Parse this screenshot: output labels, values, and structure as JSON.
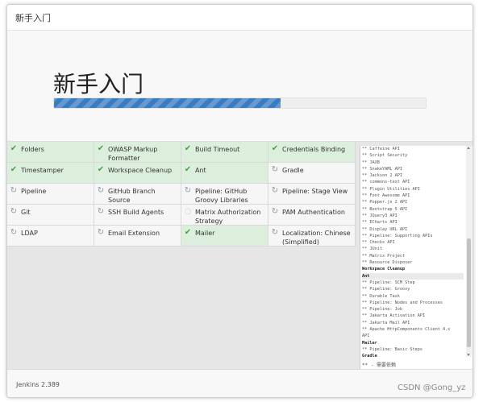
{
  "dialog": {
    "title": "新手入门"
  },
  "hero": {
    "title": "新手入门",
    "progress": 0.61
  },
  "plugins": [
    {
      "name": "Folders",
      "status": "done"
    },
    {
      "name": "OWASP Markup Formatter",
      "status": "done"
    },
    {
      "name": "Build Timeout",
      "status": "done"
    },
    {
      "name": "Credentials Binding",
      "status": "done"
    },
    {
      "name": "Timestamper",
      "status": "done"
    },
    {
      "name": "Workspace Cleanup",
      "status": "done"
    },
    {
      "name": "Ant",
      "status": "done"
    },
    {
      "name": "Gradle",
      "status": "loading"
    },
    {
      "name": "Pipeline",
      "status": "loading"
    },
    {
      "name": "GitHub Branch Source",
      "status": "loading"
    },
    {
      "name": "Pipeline: GitHub Groovy Libraries",
      "status": "loading"
    },
    {
      "name": "Pipeline: Stage View",
      "status": "loading"
    },
    {
      "name": "Git",
      "status": "loading"
    },
    {
      "name": "SSH Build Agents",
      "status": "loading"
    },
    {
      "name": "Matrix Authorization Strategy",
      "status": "pending"
    },
    {
      "name": "PAM Authentication",
      "status": "loading"
    },
    {
      "name": "LDAP",
      "status": "loading"
    },
    {
      "name": "Email Extension",
      "status": "loading"
    },
    {
      "name": "Mailer",
      "status": "done"
    },
    {
      "name": "Localization: Chinese (Simplified)",
      "status": "loading"
    }
  ],
  "log": {
    "lines": [
      {
        "text": "** Caffeine API",
        "style": "dep"
      },
      {
        "text": "** Script Security",
        "style": "dep"
      },
      {
        "text": "** JAXB",
        "style": "dep"
      },
      {
        "text": "** SnakeYAML API",
        "style": "dep"
      },
      {
        "text": "** Jackson 2 API",
        "style": "dep"
      },
      {
        "text": "** commons-text API",
        "style": "dep"
      },
      {
        "text": "** Plugin Utilities API",
        "style": "dep"
      },
      {
        "text": "** Font Awesome API",
        "style": "dep"
      },
      {
        "text": "** Popper.js 2 API",
        "style": "dep"
      },
      {
        "text": "** Bootstrap 5 API",
        "style": "dep"
      },
      {
        "text": "** JQuery3 API",
        "style": "dep"
      },
      {
        "text": "** ECharts API",
        "style": "dep"
      },
      {
        "text": "** Display URL API",
        "style": "dep"
      },
      {
        "text": "** Pipeline: Supporting APIs",
        "style": "dep"
      },
      {
        "text": "** Checks API",
        "style": "dep"
      },
      {
        "text": "** JUnit",
        "style": "dep"
      },
      {
        "text": "** Matrix Project",
        "style": "dep"
      },
      {
        "text": "** Resource Disposer",
        "style": "dep"
      },
      {
        "text": "Workspace Cleanup",
        "style": "plain"
      },
      {
        "text": "Ant",
        "style": "hl"
      },
      {
        "text": "** Pipeline: SCM Step",
        "style": "dep"
      },
      {
        "text": "** Pipeline: Groovy",
        "style": "dep"
      },
      {
        "text": "** Durable Task",
        "style": "dep"
      },
      {
        "text": "** Pipeline: Nodes and Processes",
        "style": "dep"
      },
      {
        "text": "** Pipeline: Job",
        "style": "dep"
      },
      {
        "text": "** Jakarta Activation API",
        "style": "dep"
      },
      {
        "text": "** Jakarta Mail API",
        "style": "dep"
      },
      {
        "text": "** Apache HttpComponents Client 4.x",
        "style": "dep"
      },
      {
        "text": "API",
        "style": "dep"
      },
      {
        "text": "Mailer",
        "style": "plain"
      },
      {
        "text": "** Pipeline: Basic Steps",
        "style": "dep"
      },
      {
        "text": "Gradle",
        "style": "plain"
      }
    ],
    "footer": "** - 需要依赖"
  },
  "footer": {
    "version": "Jenkins 2.389"
  },
  "watermark": "CSDN @Gong_yz",
  "icons": {
    "done": "check-icon",
    "loading": "refresh-icon",
    "pending": "pending-icon"
  }
}
